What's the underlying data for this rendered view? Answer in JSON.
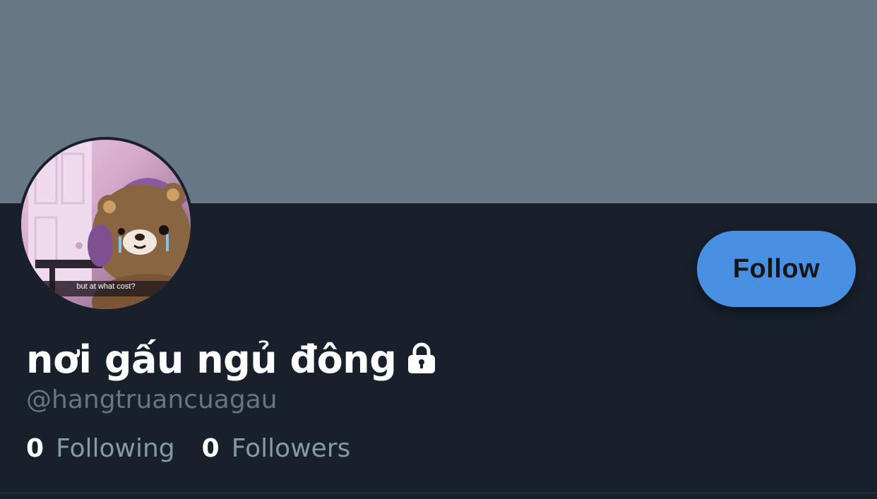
{
  "profile": {
    "display_name": "nơi gấu ngủ đông",
    "handle": "@hangtruancuagau",
    "avatar_caption": "but at what cost?",
    "follow_label": "Follow",
    "protected": true
  },
  "stats": [
    {
      "count": "0",
      "label": "Following"
    },
    {
      "count": "0",
      "label": "Followers"
    }
  ],
  "icons": {
    "lock": "lock-icon"
  },
  "colors": {
    "banner": "#687785",
    "background": "#17202b",
    "accent": "#4a90e2",
    "secondary_text": "#8899a6"
  }
}
